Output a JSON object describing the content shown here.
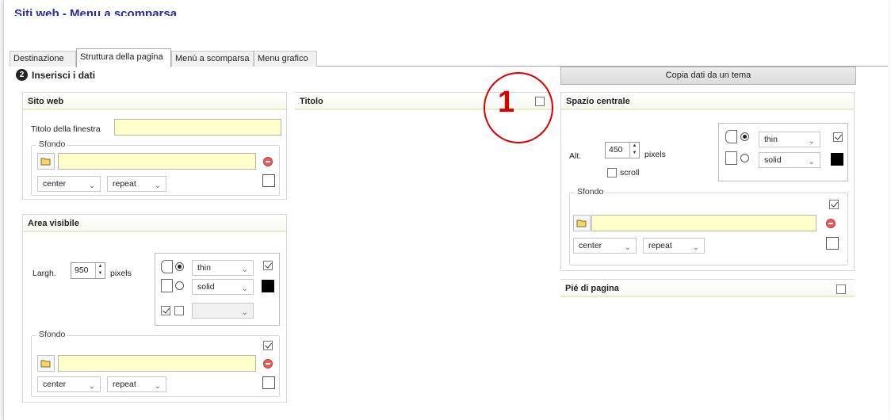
{
  "page": {
    "title": "Siti web - Menu a scomparsa"
  },
  "tabs": [
    {
      "label": "Destinazione",
      "active": false
    },
    {
      "label": "Struttura della pagina",
      "active": true
    },
    {
      "label": "Menù a scomparsa",
      "active": false
    },
    {
      "label": "Menu grafico",
      "active": false
    }
  ],
  "step": {
    "number": "2",
    "label": "Inserisci i dati"
  },
  "copy_theme_button": "Copia dati da un tema",
  "sito_web": {
    "header": "Sito web",
    "window_title_label": "Titolo della finestra",
    "window_title_value": "",
    "background_legend": "Sfondo",
    "bg_position": "center",
    "bg_repeat": "repeat"
  },
  "area_visibile": {
    "header": "Area visibile",
    "width_label": "Largh.",
    "width_value": "950",
    "unit": "pixels",
    "border_width": "thin",
    "border_style": "solid",
    "border_extra": "",
    "background_legend": "Sfondo",
    "bg_position": "center",
    "bg_repeat": "repeat"
  },
  "titolo": {
    "header": "Titolo",
    "enabled": false
  },
  "spazio_centrale": {
    "header": "Spazio centrale",
    "height_label": "Alt.",
    "height_value": "450",
    "unit": "pixels",
    "scroll_label": "scroll",
    "border_width": "thin",
    "border_style": "solid",
    "background_legend": "Sfondo",
    "bg_position": "center",
    "bg_repeat": "repeat"
  },
  "pie_di_pagina": {
    "header": "Pié di pagina",
    "enabled": false
  },
  "annotation": {
    "number": "1",
    "color": "#d80000"
  },
  "colors": {
    "input_bg": "#ffffcc",
    "title": "#2a2aa6"
  }
}
